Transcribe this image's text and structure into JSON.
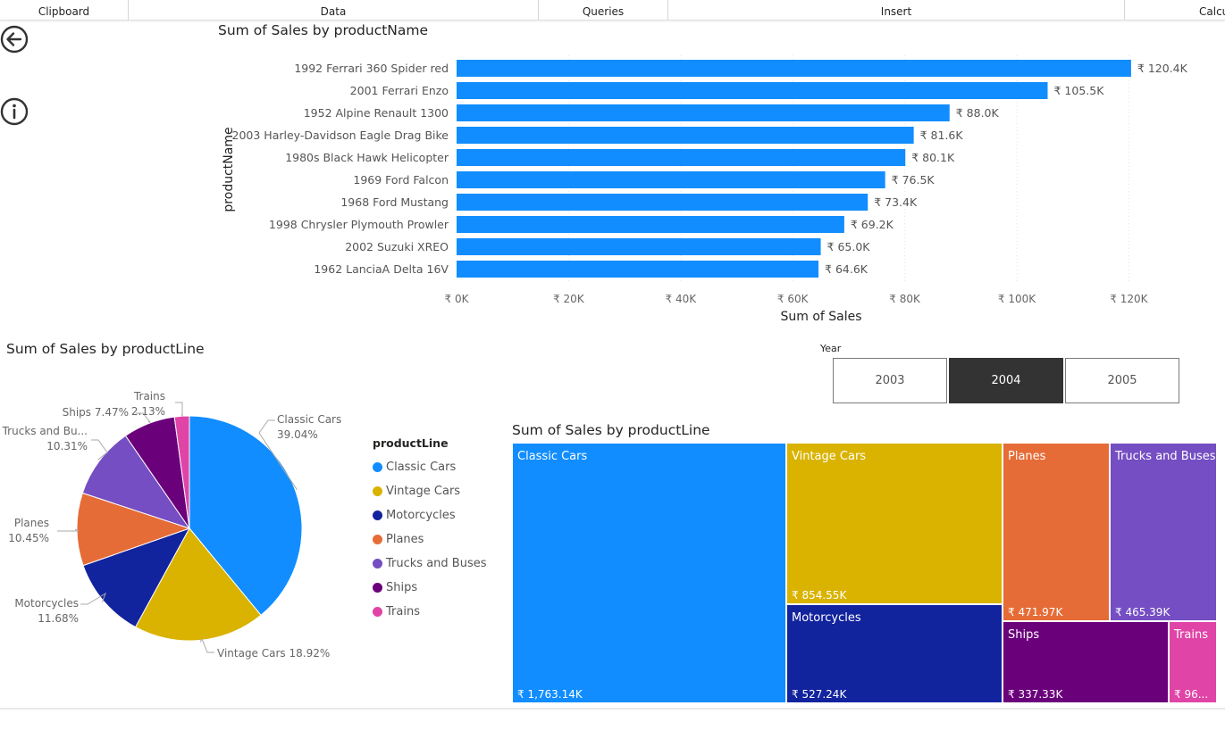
{
  "ribbon": {
    "groups": [
      "Clipboard",
      "Data",
      "Queries",
      "Insert",
      "Calcu"
    ]
  },
  "nav": {
    "back_icon": "back-arrow-icon",
    "info_icon": "info-icon"
  },
  "bar_visual": {
    "title": "Sum of Sales by productName"
  },
  "pie_visual": {
    "title": "Sum of Sales by productLine"
  },
  "treemap_visual": {
    "title": "Sum of Sales by productLine"
  },
  "slicer": {
    "title": "Year",
    "options": [
      "2003",
      "2004",
      "2005"
    ],
    "selected": "2004"
  },
  "legend": {
    "title": "productLine",
    "items": [
      "Classic Cars",
      "Vintage Cars",
      "Motorcycles",
      "Planes",
      "Trucks and Buses",
      "Ships",
      "Trains"
    ]
  },
  "colors": {
    "Classic Cars": "#118DFF",
    "Vintage Cars": "#D9B300",
    "Motorcycles": "#12239E",
    "Planes": "#E66C37",
    "Trucks and Buses": "#744EC2",
    "Ships": "#6B007B",
    "Trains": "#E044A7",
    "bar": "#118DFF"
  },
  "treemap": {
    "tiles": [
      {
        "label": "Classic Cars",
        "value": "₹ 1,763.14K"
      },
      {
        "label": "Vintage Cars",
        "value": "₹ 854.55K"
      },
      {
        "label": "Motorcycles",
        "value": "₹ 527.24K"
      },
      {
        "label": "Planes",
        "value": "₹ 471.97K"
      },
      {
        "label": "Trucks and Buses",
        "value": "₹ 465.39K"
      },
      {
        "label": "Ships",
        "value": "₹ 337.33K"
      },
      {
        "label": "Trains",
        "value": "₹ 96..."
      }
    ]
  },
  "chart_data": [
    {
      "type": "bar",
      "orientation": "horizontal",
      "title": "Sum of Sales by productName",
      "xlabel": "Sum of Sales",
      "ylabel": "productName",
      "categories": [
        "1992 Ferrari 360 Spider red",
        "2001 Ferrari Enzo",
        "1952 Alpine Renault 1300",
        "2003 Harley-Davidson Eagle Drag Bike",
        "1980s Black Hawk Helicopter",
        "1969 Ford Falcon",
        "1968 Ford Mustang",
        "1998 Chrysler Plymouth Prowler",
        "2002 Suzuki XREO",
        "1962 LanciaA Delta 16V"
      ],
      "values": [
        120.4,
        105.5,
        88.0,
        81.6,
        80.1,
        76.5,
        73.4,
        69.2,
        65.0,
        64.6
      ],
      "value_unit": "K",
      "data_labels": [
        "₹ 120.4K",
        "₹ 105.5K",
        "₹ 88.0K",
        "₹ 81.6K",
        "₹ 80.1K",
        "₹ 76.5K",
        "₹ 73.4K",
        "₹ 69.2K",
        "₹ 65.0K",
        "₹ 64.6K"
      ],
      "xticks": [
        "₹ 0K",
        "₹ 20K",
        "₹ 40K",
        "₹ 60K",
        "₹ 80K",
        "₹ 100K",
        "₹ 120K"
      ],
      "xlim": [
        0,
        120
      ],
      "grid": true
    },
    {
      "type": "pie",
      "title": "Sum of Sales by productLine",
      "categories": [
        "Classic Cars",
        "Vintage Cars",
        "Motorcycles",
        "Planes",
        "Trucks and Buses",
        "Ships",
        "Trains"
      ],
      "values": [
        39.04,
        18.92,
        11.68,
        10.45,
        10.31,
        7.47,
        2.13
      ],
      "data_labels": [
        {
          "name": "Classic Cars",
          "pct": "39.04%"
        },
        {
          "name": "Vintage Cars",
          "pct": "18.92%"
        },
        {
          "name": "Motorcycles",
          "pct": "11.68%"
        },
        {
          "name": "Planes",
          "pct": "10.45%"
        },
        {
          "name": "Trucks and Bu...",
          "pct": "10.31%"
        },
        {
          "name": "Ships",
          "pct": "7.47%"
        },
        {
          "name": "Trains",
          "pct": "2.13%"
        }
      ],
      "legend_position": "right"
    },
    {
      "type": "treemap",
      "title": "Sum of Sales by productLine",
      "categories": [
        "Classic Cars",
        "Vintage Cars",
        "Motorcycles",
        "Planes",
        "Trucks and Buses",
        "Ships",
        "Trains"
      ],
      "values": [
        1763.14,
        854.55,
        527.24,
        471.97,
        465.39,
        337.33,
        96
      ],
      "value_unit": "K"
    }
  ]
}
